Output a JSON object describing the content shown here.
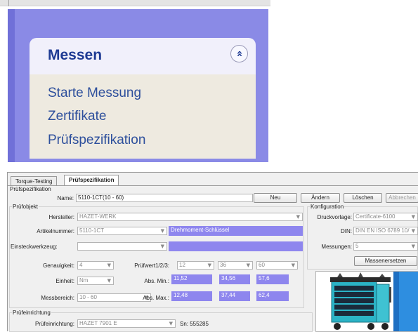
{
  "sidebar": {
    "title": "Messen",
    "collapse_icon": "double-chevron-up-icon",
    "collapse_glyph": "»",
    "items": [
      {
        "label": "Starte Messung"
      },
      {
        "label": "Zertifikate"
      },
      {
        "label": "Prüfspezifikation"
      }
    ],
    "colors": {
      "frame": "#8a8ae6",
      "title": "#1e3a93",
      "link": "#2d4f9c",
      "body": "#eeeae0"
    }
  },
  "tabs": [
    {
      "label": "Torque-Testing",
      "active": false
    },
    {
      "label": "Prüfspezifikation",
      "active": true
    }
  ],
  "form": {
    "section_title": "Prüfspezifikation",
    "name_label": "Name:",
    "name_value": "5110-1CT(10 - 60)",
    "buttons": {
      "neu": "Neu",
      "aendern": "Ändern",
      "loeschen": "Löschen",
      "abbrechen": "Abbrechen"
    },
    "pruefobjekt": {
      "title": "Prüfobjekt",
      "hersteller_label": "Hersteller:",
      "hersteller_value": "HAZET-WERK",
      "artikel_label": "Artikelnummer:",
      "artikel_value": "5110-1CT",
      "artikel_desc": "Drehmoment-Schlüssel",
      "einsteck_label": "Einsteckwerkzeug:",
      "einsteck_value": "",
      "einsteck_desc": "",
      "genauigkeit_label": "Genauigkeit:",
      "genauigkeit_value": "4",
      "einheit_label": "Einheit:",
      "einheit_value": "Nm",
      "messbereich_label": "Messbereich:",
      "messbereich_value": "10 - 60",
      "pruefwert_label": "Prüfwert1/2/3:",
      "pruefwerte": [
        "12",
        "36",
        "60"
      ],
      "absmin_label": "Abs. Min.:",
      "absmin_values": [
        "11,52",
        "34,56",
        "57,6"
      ],
      "absmax_label": "Abs. Max.:",
      "absmax_values": [
        "12,48",
        "37,44",
        "62,4"
      ]
    },
    "konfiguration": {
      "title": "Konfiguration",
      "druck_label": "Druckvorlage:",
      "druck_value": "Certificate-6100",
      "din_label": "DIN:",
      "din_value": "DIN EN ISO 6789 10/",
      "messungen_label": "Messungen:",
      "messungen_value": "5",
      "massen_button": "Massenersetzen"
    },
    "pruefeinrichtung": {
      "title": "Prüfeinrichtung",
      "label": "Prüfeinrichtung:",
      "value": "HAZET 7901 E",
      "sn": "Sn: 555285"
    },
    "image_alt": "tool-cart-image",
    "colors": {
      "highlight": "#8e86ee",
      "window": "#f0f0f0"
    }
  }
}
